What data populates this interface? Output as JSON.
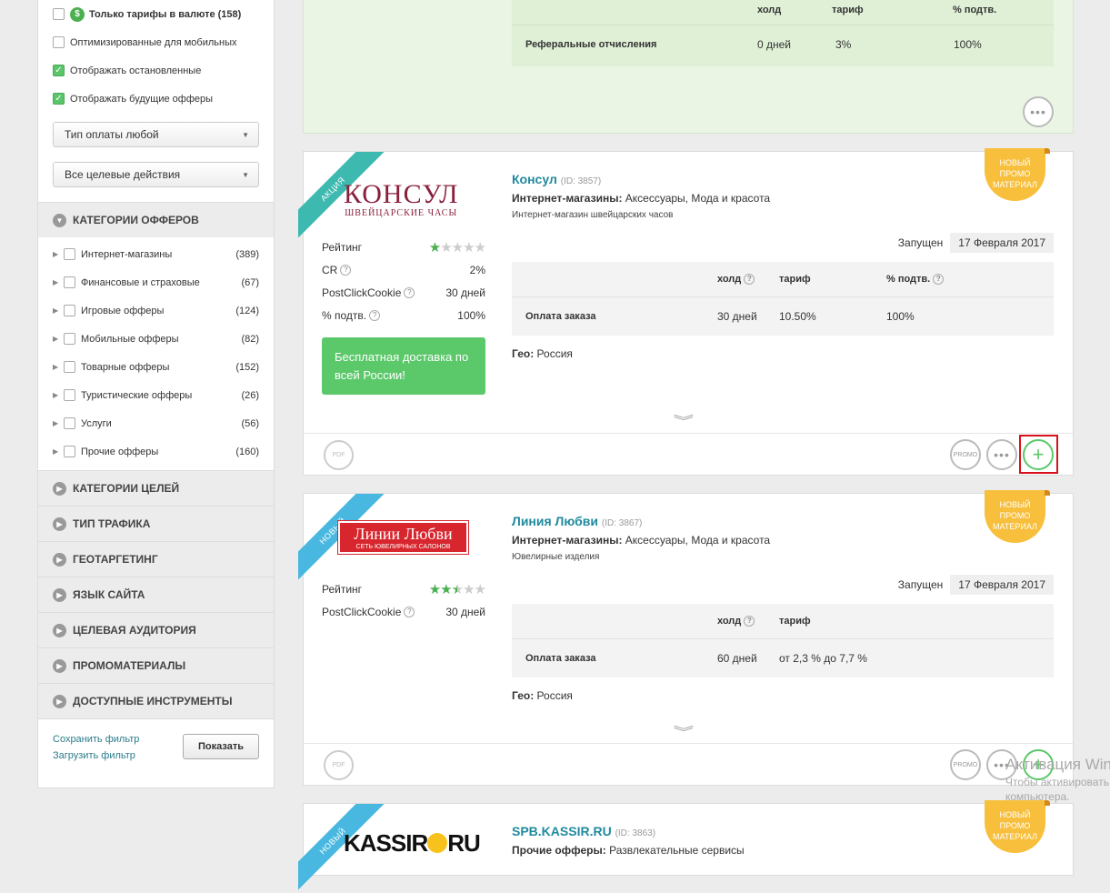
{
  "filters": {
    "checkboxes": [
      {
        "label": "Только тарифы в валюте (158)",
        "checked": false,
        "bold": true,
        "icon": "dollar-icon"
      },
      {
        "label": "Оптимизированные для мобильных",
        "checked": false
      },
      {
        "label": "Отображать остановленные",
        "checked": true
      },
      {
        "label": "Отображать будущие офферы",
        "checked": true
      }
    ],
    "payment_select": "Тип оплаты любой",
    "action_select": "Все целевые действия",
    "categories_title": "КАТЕГОРИИ ОФФЕРОВ",
    "categories": [
      {
        "label": "Интернет-магазины",
        "count": "(389)"
      },
      {
        "label": "Финансовые и страховые",
        "count": "(67)"
      },
      {
        "label": "Игровые офферы",
        "count": "(124)"
      },
      {
        "label": "Мобильные офферы",
        "count": "(82)"
      },
      {
        "label": "Товарные офферы",
        "count": "(152)"
      },
      {
        "label": "Туристические офферы",
        "count": "(26)"
      },
      {
        "label": "Услуги",
        "count": "(56)"
      },
      {
        "label": "Прочие офферы",
        "count": "(160)"
      }
    ],
    "sections": [
      "КАТЕГОРИИ ЦЕЛЕЙ",
      "ТИП ТРАФИКА",
      "ГЕОТАРГЕТИНГ",
      "ЯЗЫК САЙТА",
      "ЦЕЛЕВАЯ АУДИТОРИЯ",
      "ПРОМОМАТЕРИАЛЫ",
      "ДОСТУПНЫЕ ИНСТРУМЕНТЫ"
    ],
    "save_filter": "Сохранить фильтр",
    "load_filter": "Загрузить фильтр",
    "show_button": "Показать"
  },
  "top_card": {
    "headers": {
      "hold": "холд",
      "tariff": "тариф",
      "approve": "% подтв."
    },
    "row": {
      "name": "Реферальные отчисления",
      "hold": "0 дней",
      "tariff": "3%",
      "approve": "100%"
    }
  },
  "offers": [
    {
      "ribbon": "АКЦИЯ",
      "badge": [
        "НОВЫЙ",
        "ПРОМО",
        "МАТЕРИАЛ"
      ],
      "logo_main": "КОНСУЛ",
      "logo_sub": "ШВЕЙЦАРСКИЕ ЧАСЫ",
      "name": "Консул",
      "id": "(ID: 3857)",
      "category_label": "Интернет-магазины:",
      "category_value": " Аксессуары, Мода и красота",
      "description": "Интернет-магазин швейцарских часов",
      "launched_label": "Запущен",
      "launched_date": "17 Февраля 2017",
      "rating_label": "Рейтинг",
      "rating": 1,
      "cr_label": "CR",
      "cr_value": "2%",
      "pcc_label": "PostClickCookie",
      "pcc_value": "30 дней",
      "approve_label": "% подтв.",
      "approve_value": "100%",
      "promo_box": "Бесплатная доставка по всей России!",
      "headers": {
        "hold": "холд",
        "tariff": "тариф",
        "approve": "% подтв."
      },
      "row": {
        "name": "Оплата заказа",
        "hold": "30 дней",
        "tariff": "10.50%",
        "approve": "100%"
      },
      "geo_label": "Гео:",
      "geo_value": " Россия"
    },
    {
      "ribbon": "НОВЫЙ",
      "badge": [
        "НОВЫЙ",
        "ПРОМО",
        "МАТЕРИАЛ"
      ],
      "logo_main": "Линии Любви",
      "logo_sub": "СЕТЬ ЮВЕЛИРНЫХ САЛОНОВ",
      "name": "Линия Любви",
      "id": "(ID: 3867)",
      "category_label": "Интернет-магазины:",
      "category_value": " Аксессуары, Мода и красота",
      "description": "Ювелирные изделия",
      "launched_label": "Запущен",
      "launched_date": "17 Февраля 2017",
      "rating_label": "Рейтинг",
      "rating": 2.5,
      "pcc_label": "PostClickCookie",
      "pcc_value": "30 дней",
      "headers": {
        "hold": "холд",
        "tariff": "тариф"
      },
      "row": {
        "name": "Оплата заказа",
        "hold": "60 дней",
        "tariff": "от 2,3 % до 7,7 %"
      },
      "geo_label": "Гео:",
      "geo_value": " Россия"
    },
    {
      "ribbon": "НОВЫЙ",
      "badge": [
        "НОВЫЙ",
        "ПРОМО",
        "МАТЕРИАЛ"
      ],
      "logo_left": "KASSIR",
      "logo_right": "RU",
      "name": "SPB.KASSIR.RU",
      "id": "(ID: 3863)",
      "category_label": "Прочие офферы:",
      "category_value": " Развлекательные сервисы"
    }
  ],
  "footer_buttons": {
    "promo": "PROMO",
    "doc": "PDF"
  },
  "watermark": {
    "line1": "Активация Windows",
    "line2": "Чтобы активировать Windows, перейдите в раздел",
    "line3": "компьютера."
  }
}
